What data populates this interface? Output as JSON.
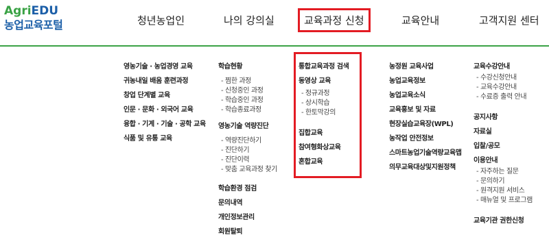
{
  "logo": {
    "agri": "Agri",
    "edu": "EDU",
    "portal": "농업교육포털"
  },
  "gnb": [
    {
      "label": "청년농업인"
    },
    {
      "label": "나의 강의실"
    },
    {
      "label": "교육과정 신청"
    },
    {
      "label": "교육안내"
    },
    {
      "label": "고객지원 센터"
    }
  ],
  "col1": {
    "items": [
      "영농기술 · 농업경영 교육",
      "귀농내일 배움 훈련과정",
      "창업 단계별 교육",
      "인문 · 문화 · 외국어 교육",
      "융합 · 기계 · 기술 · 공학 교육",
      "식품 및 유통 교육"
    ]
  },
  "col2": {
    "g1_title": "학습현황",
    "g1_subs": [
      "찜한 과정",
      "신청중인 과정",
      "학습중인 과정",
      "학습종료과정"
    ],
    "g2_title": "영농기술 역량진단",
    "g2_subs": [
      "역량진단하기",
      "진단하기",
      "진단이력",
      "맞춤 교육과정 찾기"
    ],
    "items": [
      "학습환경 점검",
      "문의내역",
      "개인정보관리",
      "회원탈퇴"
    ]
  },
  "col3": {
    "item1": "통합교육과정 검색",
    "item2": "동영상 교육",
    "subs": [
      "정규과정",
      "상시학습",
      "한토막강의"
    ],
    "item3": "집합교육",
    "item4": "참여형화상교육",
    "item5": "혼합교육"
  },
  "col4": {
    "items": [
      "농정원 교육사업",
      "농업교육정보",
      "농업교육소식",
      "교육홍보 및 자료",
      "현장실습교육장(WPL)",
      "농작업 안전정보",
      "스마트농업기술역량교육맵",
      "의무교육대상및지원정책"
    ]
  },
  "col5": {
    "g1_title": "교육수강안내",
    "g1_subs": [
      "수강신청안내",
      "교육수강안내",
      "수료증 출력 안내"
    ],
    "items_a": [
      "공지사항",
      "자료실",
      "입찰/공모"
    ],
    "g2_title": "이용안내",
    "g2_subs": [
      "자주하는 질문",
      "문의하기",
      "원격지원 서비스",
      "매뉴얼 및 프로그램"
    ],
    "item_last": "교육기관 권한신청"
  }
}
